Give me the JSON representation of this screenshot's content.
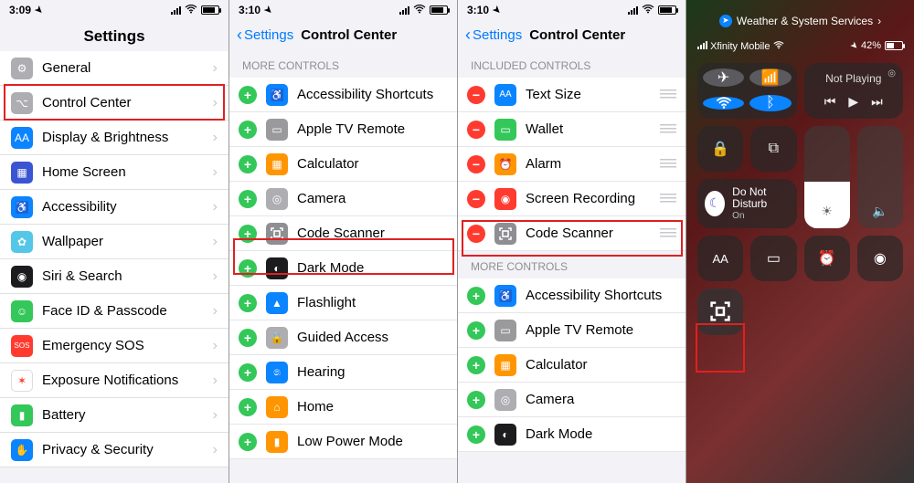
{
  "statusbar1": {
    "time": "3:09",
    "right": ""
  },
  "statusbar2": {
    "time": "3:10"
  },
  "statusbar3": {
    "time": "3:10"
  },
  "panel1": {
    "title": "Settings",
    "rows": [
      {
        "icon": "general",
        "label": "General",
        "bg": "#aeaeb2"
      },
      {
        "icon": "control-center",
        "label": "Control Center",
        "bg": "#aeaeb2"
      },
      {
        "icon": "display",
        "label": "Display & Brightness",
        "bg": "#0a84ff"
      },
      {
        "icon": "home-screen",
        "label": "Home Screen",
        "bg": "#3955d1"
      },
      {
        "icon": "accessibility",
        "label": "Accessibility",
        "bg": "#0a84ff"
      },
      {
        "icon": "wallpaper",
        "label": "Wallpaper",
        "bg": "#54c7e8"
      },
      {
        "icon": "siri",
        "label": "Siri & Search",
        "bg": "#1c1c1e"
      },
      {
        "icon": "faceid",
        "label": "Face ID & Passcode",
        "bg": "#34c759"
      },
      {
        "icon": "sos",
        "label": "Emergency SOS",
        "bg": "#ff3b30",
        "txt": "SOS"
      },
      {
        "icon": "exposure",
        "label": "Exposure Notifications",
        "bg": "#ffffff",
        "fg": "#ff3b30",
        "bord": "#ddd"
      },
      {
        "icon": "battery",
        "label": "Battery",
        "bg": "#34c759"
      },
      {
        "icon": "privacy",
        "label": "Privacy & Security",
        "bg": "#0a84ff"
      }
    ]
  },
  "panel2": {
    "back": "Settings",
    "title": "Control Center",
    "section": "MORE CONTROLS",
    "rows": [
      {
        "label": "Accessibility Shortcuts",
        "bg": "#0a84ff"
      },
      {
        "label": "Apple TV Remote",
        "bg": "#9a9a9d"
      },
      {
        "label": "Calculator",
        "bg": "#ff9500"
      },
      {
        "label": "Camera",
        "bg": "#aeaeb2"
      },
      {
        "label": "Code Scanner",
        "bg": "#8e8e93"
      },
      {
        "label": "Dark Mode",
        "bg": "#1c1c1e"
      },
      {
        "label": "Flashlight",
        "bg": "#0a84ff"
      },
      {
        "label": "Guided Access",
        "bg": "#aeaeb2"
      },
      {
        "label": "Hearing",
        "bg": "#0a84ff"
      },
      {
        "label": "Home",
        "bg": "#ff9500"
      },
      {
        "label": "Low Power Mode",
        "bg": "#ff9500"
      }
    ]
  },
  "panel3": {
    "back": "Settings",
    "title": "Control Center",
    "section_inc": "INCLUDED CONTROLS",
    "section_more": "MORE CONTROLS",
    "included": [
      {
        "label": "Text Size",
        "bg": "#0a84ff",
        "txt": "AA"
      },
      {
        "label": "Wallet",
        "bg": "#34c759"
      },
      {
        "label": "Alarm",
        "bg": "#ff9500"
      },
      {
        "label": "Screen Recording",
        "bg": "#ff3b30"
      },
      {
        "label": "Code Scanner",
        "bg": "#8e8e93"
      }
    ],
    "more": [
      {
        "label": "Accessibility Shortcuts",
        "bg": "#0a84ff"
      },
      {
        "label": "Apple TV Remote",
        "bg": "#9a9a9d"
      },
      {
        "label": "Calculator",
        "bg": "#ff9500"
      },
      {
        "label": "Camera",
        "bg": "#aeaeb2"
      },
      {
        "label": "Dark Mode",
        "bg": "#1c1c1e"
      }
    ]
  },
  "cc": {
    "top": "Weather & System Services",
    "carrier": "Xfinity Mobile",
    "battery": "42%",
    "media": "Not Playing",
    "dnd_title": "Do Not Disturb",
    "dnd_sub": "On",
    "text_aa": "AA"
  }
}
